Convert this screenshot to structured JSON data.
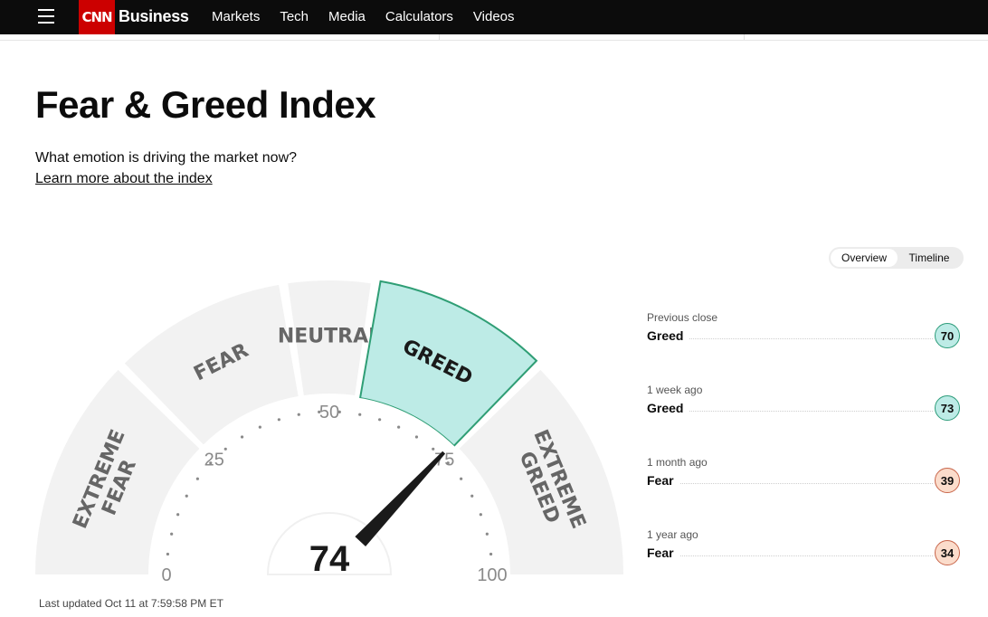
{
  "header": {
    "brand": "Business",
    "logo_text": "CNN",
    "nav": [
      "Markets",
      "Tech",
      "Media",
      "Calculators",
      "Videos"
    ]
  },
  "page": {
    "title": "Fear & Greed Index",
    "subtitle": "What emotion is driving the market now?",
    "learn_link": "Learn more about the index",
    "last_updated": "Last updated Oct 11 at 7:59:58 PM ET"
  },
  "toggle": {
    "overview": "Overview",
    "timeline": "Timeline"
  },
  "gauge": {
    "value": 74,
    "segments": [
      {
        "label_lines": [
          "EXTREME",
          "FEAR"
        ],
        "from": 0,
        "to": 25
      },
      {
        "label_lines": [
          "FEAR"
        ],
        "from": 25,
        "to": 45
      },
      {
        "label_lines": [
          "NEUTRAL"
        ],
        "from": 45,
        "to": 55
      },
      {
        "label_lines": [
          "GREED"
        ],
        "from": 55,
        "to": 75,
        "active": true
      },
      {
        "label_lines": [
          "EXTREME",
          "GREED"
        ],
        "from": 75,
        "to": 100
      }
    ],
    "ticks": [
      "0",
      "25",
      "50",
      "75",
      "100"
    ]
  },
  "history": [
    {
      "label": "Previous close",
      "rating": "Greed",
      "value": "70",
      "color": "#bdebe6",
      "border": "#2c9c7a"
    },
    {
      "label": "1 week ago",
      "rating": "Greed",
      "value": "73",
      "color": "#bdebe6",
      "border": "#2c9c7a"
    },
    {
      "label": "1 month ago",
      "rating": "Fear",
      "value": "39",
      "color": "#fbdccb",
      "border": "#c8654a"
    },
    {
      "label": "1 year ago",
      "rating": "Fear",
      "value": "34",
      "color": "#fbdccb",
      "border": "#c8654a"
    }
  ]
}
